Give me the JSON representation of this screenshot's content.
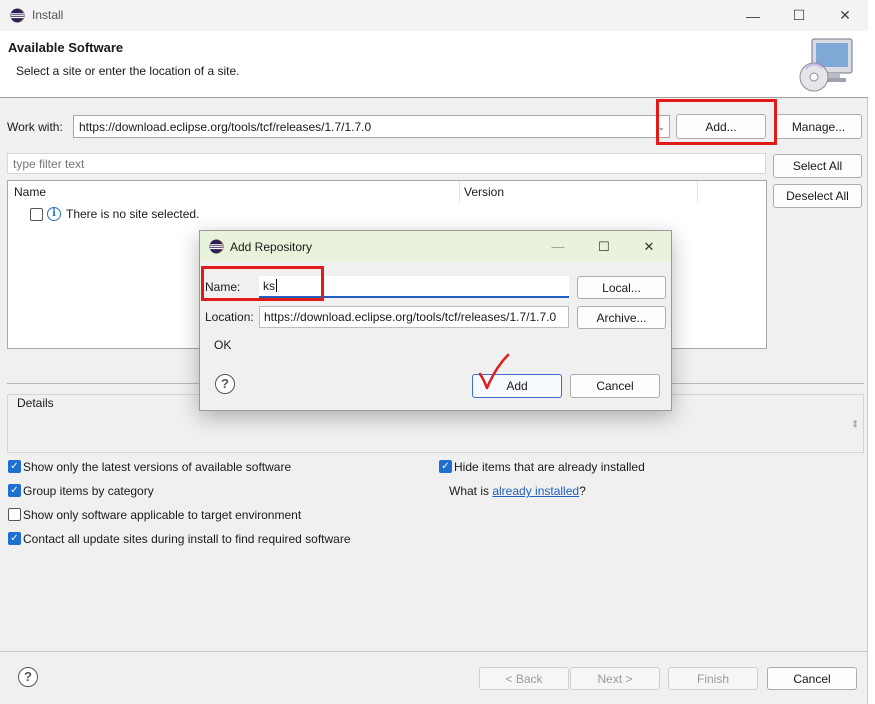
{
  "window": {
    "title": "Install",
    "minimize": "—",
    "maximize": "☐",
    "close": "✕"
  },
  "header": {
    "title": "Available Software",
    "subtitle": "Select a site or enter the location of a site."
  },
  "work_with": {
    "label": "Work with:",
    "value": "https://download.eclipse.org/tools/tcf/releases/1.7/1.7.0",
    "add_label": "Add...",
    "manage_label": "Manage..."
  },
  "filter": {
    "placeholder": "type filter text",
    "select_all_label": "Select All",
    "deselect_all_label": "Deselect All"
  },
  "tree": {
    "columns": [
      "Name",
      "Version"
    ],
    "rows": [
      {
        "text": "There is no site selected."
      }
    ]
  },
  "details": {
    "label": "Details"
  },
  "options": {
    "show_latest": {
      "label": "Show only the latest versions of available software",
      "checked": true
    },
    "group_by_category": {
      "label": "Group items by category",
      "checked": true
    },
    "show_applicable": {
      "label": "Show only software applicable to target environment",
      "checked": false
    },
    "contact_sites": {
      "label": "Contact all update sites during install to find required software",
      "checked": true
    },
    "hide_installed": {
      "label": "Hide items that are already installed",
      "checked": true
    },
    "what_is_prefix": "What is ",
    "already_installed_link": "already installed",
    "what_is_suffix": "?"
  },
  "footer": {
    "back_label": "< Back",
    "next_label": "Next >",
    "finish_label": "Finish",
    "cancel_label": "Cancel"
  },
  "dialog": {
    "title": "Add Repository",
    "minimize": "—",
    "maximize": "☐",
    "close": "✕",
    "name_label": "Name:",
    "name_value": "ks",
    "local_label": "Local...",
    "location_label": "Location:",
    "location_value": "https://download.eclipse.org/tools/tcf/releases/1.7/1.7.0",
    "archive_label": "Archive...",
    "status": "OK",
    "add_label": "Add",
    "cancel_label": "Cancel"
  },
  "colors": {
    "annotation_red": "#e11a1a",
    "accent_blue": "#1f6fd1",
    "dialog_title_bg": "#e9f3dc"
  }
}
